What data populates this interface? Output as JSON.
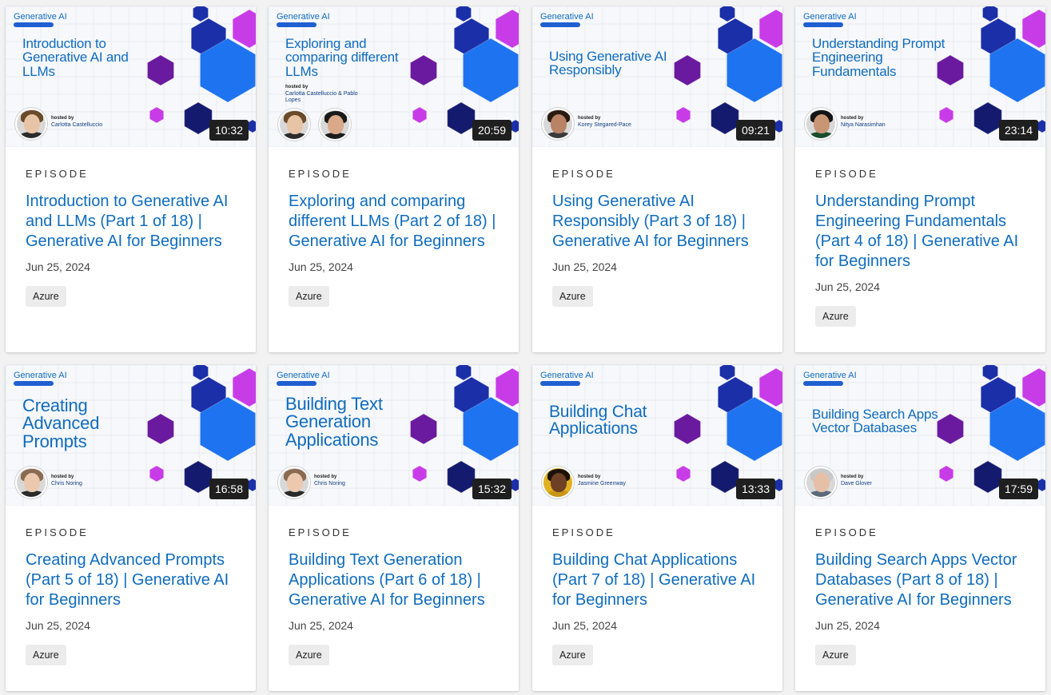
{
  "cards": [
    {
      "series": "Generative AI",
      "thumb_title": "Introduction to Generative AI and LLMs",
      "hosted_label": "hosted by",
      "hosts": "Carlotta Castelluccio",
      "duration": "10:32",
      "kicker": "EPISODE",
      "title": "Introduction to Generative AI and LLMs (Part 1 of 18) | Generative AI for Beginners",
      "date": "Jun 25, 2024",
      "tag": "Azure"
    },
    {
      "series": "Generative AI",
      "thumb_title": "Exploring and comparing different LLMs",
      "hosted_label": "hosted by",
      "hosts": "Carlotta Castelluccio & Pablo Lopes",
      "duration": "20:59",
      "kicker": "EPISODE",
      "title": "Exploring and comparing different LLMs (Part 2 of 18) | Generative AI for Beginners",
      "date": "Jun 25, 2024",
      "tag": "Azure"
    },
    {
      "series": "Generative AI",
      "thumb_title": "Using Generative AI Responsibly",
      "hosted_label": "hosted by",
      "hosts": "Korey Stegared-Pace",
      "duration": "09:21",
      "kicker": "EPISODE",
      "title": "Using Generative AI Responsibly (Part 3 of 18) | Generative AI for Beginners",
      "date": "Jun 25, 2024",
      "tag": "Azure"
    },
    {
      "series": "Generative AI",
      "thumb_title": "Understanding Prompt Engineering Fundamentals",
      "hosted_label": "hosted by",
      "hosts": "Nitya Narasimhan",
      "duration": "23:14",
      "kicker": "EPISODE",
      "title": "Understanding Prompt Engineering Fundamentals (Part 4 of 18) | Generative AI for Beginners",
      "date": "Jun 25, 2024",
      "tag": "Azure"
    },
    {
      "series": "Generative AI",
      "thumb_title": "Creating Advanced Prompts",
      "hosted_label": "hosted by",
      "hosts": "Chris Noring",
      "duration": "16:58",
      "kicker": "EPISODE",
      "title": "Creating Advanced Prompts (Part 5 of 18) | Generative AI for Beginners",
      "date": "Jun 25, 2024",
      "tag": "Azure"
    },
    {
      "series": "Generative AI",
      "thumb_title": "Building Text Generation Applications",
      "hosted_label": "hosted by",
      "hosts": "Chris Noring",
      "duration": "15:32",
      "kicker": "EPISODE",
      "title": "Building Text Generation Applications (Part 6 of 18) | Generative AI for Beginners",
      "date": "Jun 25, 2024",
      "tag": "Azure"
    },
    {
      "series": "Generative AI",
      "thumb_title": "Building Chat Applications",
      "hosted_label": "hosted by",
      "hosts": "Jasmine Greenway",
      "duration": "13:33",
      "kicker": "EPISODE",
      "title": "Building Chat Applications (Part 7 of 18) | Generative AI for Beginners",
      "date": "Jun 25, 2024",
      "tag": "Azure"
    },
    {
      "series": "Generative AI",
      "thumb_title": "Building Search Apps Vector Databases",
      "hosted_label": "hosted by",
      "hosts": "Dave Glover",
      "duration": "17:59",
      "kicker": "EPISODE",
      "title": "Building Search Apps Vector Databases (Part 8 of 18) | Generative AI for Beginners",
      "date": "Jun 25, 2024",
      "tag": "Azure"
    }
  ],
  "colors": {
    "accent_blue": "#0f6cbd",
    "hex_dark_blue": "#1a2fa8",
    "hex_bright_blue": "#1e73f0",
    "hex_purple": "#6a1a9e",
    "hex_magenta": "#c83ce8",
    "duration_bg": "#1f1f1f",
    "tag_bg": "#ececec"
  }
}
